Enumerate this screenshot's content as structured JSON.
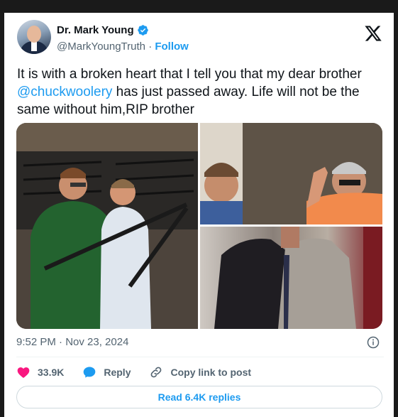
{
  "author": {
    "name": "Dr. Mark Young",
    "handle": "@MarkYoungTruth",
    "separator": "·",
    "follow_label": "Follow",
    "verified": true
  },
  "tweet": {
    "text_before": "It is with a broken heart that I tell you that my dear brother ",
    "mention": "@chuckwoolery",
    "text_after": "  has just passed away. Life will not be the same without him,RIP brother"
  },
  "meta": {
    "timestamp": "9:52 PM · Nov 23, 2024"
  },
  "actions": {
    "likes_count": "33.9K",
    "reply_label": "Reply",
    "copy_link_label": "Copy link to post"
  },
  "read_replies_label": "Read 6.4K replies",
  "icons": {
    "brand": "x-logo-icon",
    "verified": "verified-badge-icon",
    "like": "heart-icon",
    "reply": "reply-bubble-icon",
    "link": "link-icon",
    "info": "info-icon"
  },
  "colors": {
    "accent": "#1d9bf0",
    "like": "#f91880",
    "muted": "#536471",
    "text": "#0f1419"
  }
}
